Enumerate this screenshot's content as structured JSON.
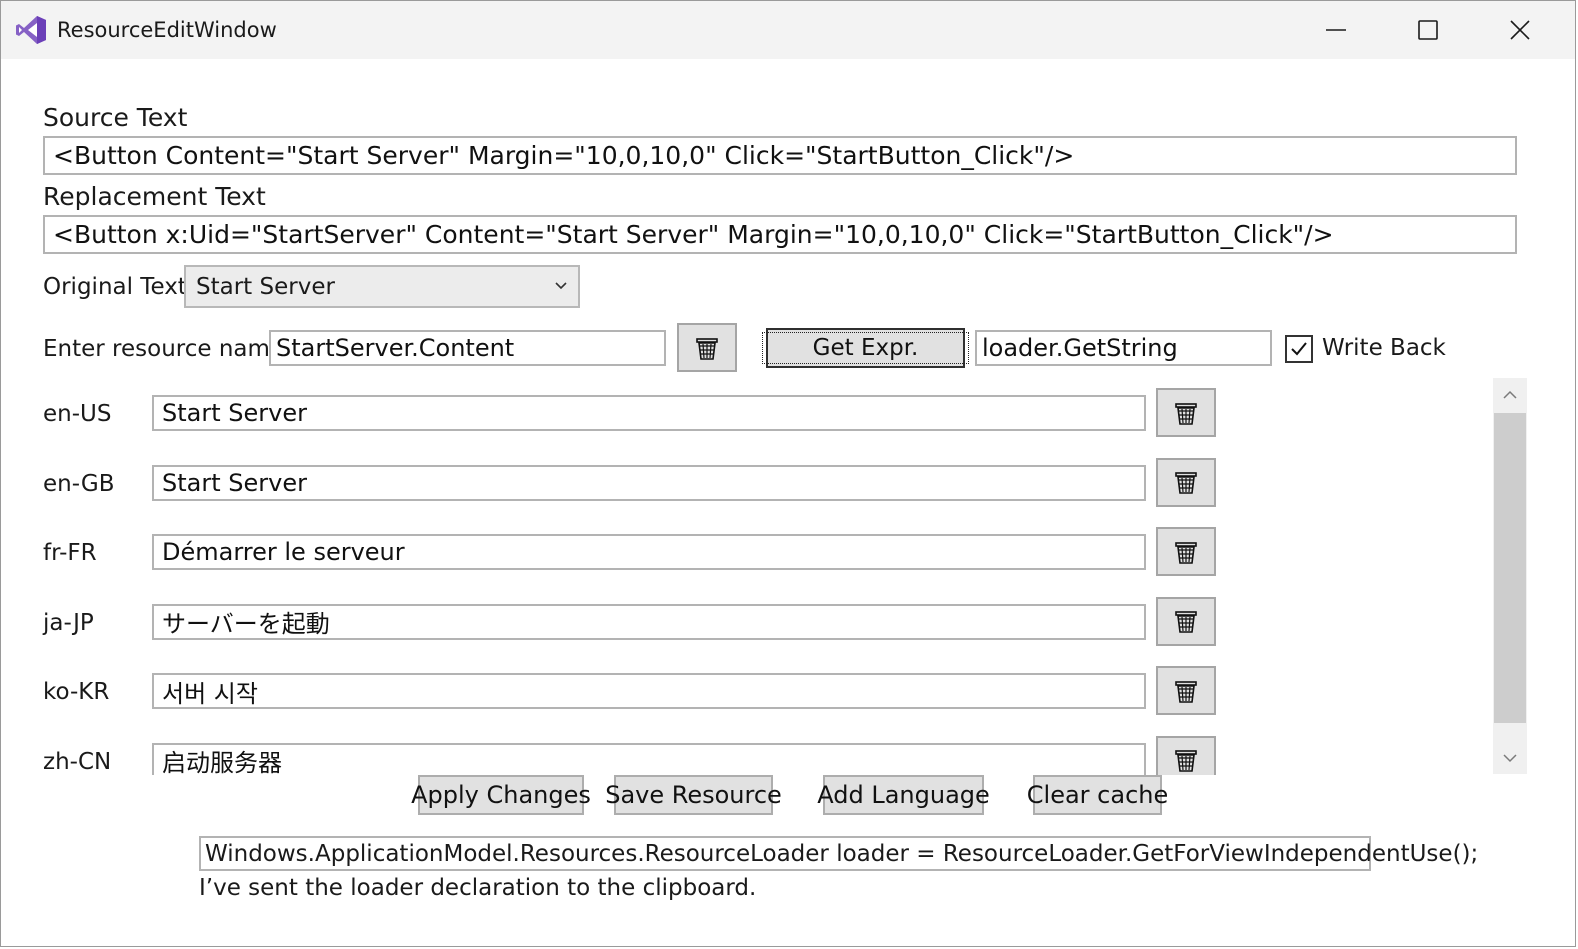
{
  "window": {
    "title": "ResourceEditWindow",
    "minimize_glyph": "—",
    "maximize_glyph": "☐",
    "close_glyph": "✕"
  },
  "source": {
    "label": "Source Text",
    "value": "<Button Content=\"Start Server\" Margin=\"10,0,10,0\" Click=\"StartButton_Click\"/>"
  },
  "replacement": {
    "label": "Replacement Text",
    "value": "<Button x:Uid=\"StartServer\" Content=\"Start Server\" Margin=\"10,0,10,0\" Click=\"StartButton_Click\"/>"
  },
  "original": {
    "label": "Original Text",
    "selected": "Start Server"
  },
  "resource": {
    "label": "Enter resource name",
    "value": "StartServer.Content",
    "get_expr_label": "Get Expr.",
    "expr_value": "loader.GetString",
    "write_back_label": "Write Back",
    "write_back_checked": true
  },
  "languages": [
    {
      "code": "en-US",
      "value": "Start Server"
    },
    {
      "code": "en-GB",
      "value": "Start Server"
    },
    {
      "code": "fr-FR",
      "value": "Démarrer le serveur"
    },
    {
      "code": "ja-JP",
      "value": "サーバーを起動"
    },
    {
      "code": "ko-KR",
      "value": "서버 시작"
    },
    {
      "code": "zh-CN",
      "value": "启动服务器"
    }
  ],
  "actions": {
    "apply": "Apply Changes",
    "save": "Save Resource",
    "add_language": "Add Language",
    "clear_cache": "Clear cache"
  },
  "loader_declaration": "Windows.ApplicationModel.Resources.ResourceLoader loader = ResourceLoader.GetForViewIndependentUse();",
  "status_message": "I’ve sent the loader declaration to the clipboard.",
  "icons": {
    "app": "visual-studio-icon",
    "trash": "trash-icon",
    "dropdown": "chevron-down-icon"
  },
  "colors": {
    "titlebar_bg": "#f3f3f3",
    "button_bg": "#e1e1e1",
    "app_icon": "#7a4fc9"
  }
}
